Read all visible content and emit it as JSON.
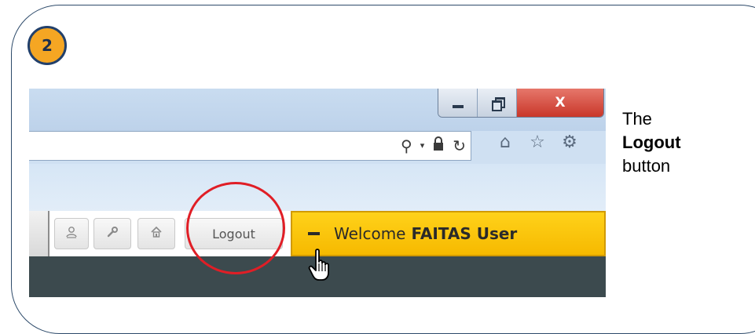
{
  "step": {
    "number": "2"
  },
  "window_controls": {
    "minimize_icon": "minimize-icon",
    "restore_icon": "restore-icon",
    "close_icon": "close-icon",
    "close_label": "X"
  },
  "address_bar": {
    "value": "",
    "icons": [
      "search-icon",
      "dropdown-caret-icon",
      "lock-icon",
      "refresh-icon"
    ],
    "search_glyph": "⚲",
    "caret_glyph": "▾",
    "lock_glyph": "🔒",
    "refresh_glyph": "↻"
  },
  "browser_tools": {
    "icons": [
      "home-icon",
      "favorites-star-icon",
      "settings-gear-icon"
    ],
    "home_glyph": "⌂",
    "star_glyph": "☆",
    "gear_glyph": "⚙"
  },
  "page_toolbar": {
    "buttons": [
      {
        "name": "profile-button",
        "icon": "user-icon",
        "glyph": "♙"
      },
      {
        "name": "tools-button",
        "icon": "wrench-icon",
        "glyph": "🔧"
      },
      {
        "name": "home-button",
        "icon": "home-icon",
        "glyph": "⌂"
      }
    ],
    "logout_label": "Logout",
    "welcome_prefix": "Welcome",
    "welcome_user": "FAITAS User"
  },
  "annotation": {
    "line1": "The",
    "line2": "Logout",
    "line3": "button"
  },
  "colors": {
    "badge_fill": "#f5a623",
    "badge_border": "#22406b",
    "highlight_ring": "#e01e26",
    "welcome_bar": "#ffc800",
    "close_button": "#c9372a",
    "frame_border": "#2d4a6a"
  }
}
